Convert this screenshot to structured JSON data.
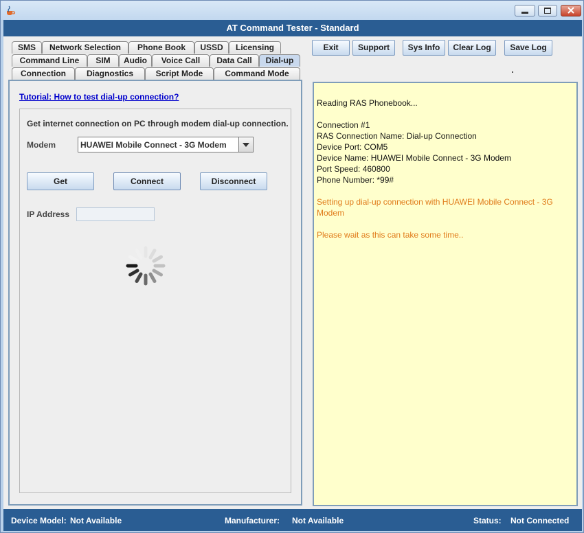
{
  "window": {
    "title": "AT Command Tester - Standard"
  },
  "tabs": {
    "row1": [
      "SMS",
      "Network Selection",
      "Phone Book",
      "USSD",
      "Licensing"
    ],
    "row2": [
      "Command Line",
      "SIM",
      "Audio",
      "Voice Call",
      "Data Call",
      "Dial-up"
    ],
    "row3": [
      "Connection",
      "Diagnostics",
      "Script Mode",
      "Command Mode"
    ],
    "active": "Dial-up"
  },
  "toolbar": {
    "exit": "Exit",
    "support": "Support",
    "sysinfo": "Sys Info",
    "clearlog": "Clear Log",
    "savelog": "Save Log"
  },
  "dialup": {
    "tutorial_link": "Tutorial: How to test dial-up connection?",
    "description": "Get internet connection on PC through modem dial-up connection.",
    "modem_label": "Modem",
    "modem_value": "HUAWEI Mobile Connect - 3G Modem",
    "get_button": "Get",
    "connect_button": "Connect",
    "disconnect_button": "Disconnect",
    "ip_label": "IP Address",
    "ip_value": ""
  },
  "log": {
    "lines": [
      "Reading RAS Phonebook...",
      "Connection #1",
      "RAS Connection Name: Dial-up Connection",
      "Device Port: COM5",
      "Device Name: HUAWEI Mobile Connect - 3G Modem",
      "Port Speed: 460800",
      "Phone Number: *99#",
      "Setting up dial-up connection with HUAWEI Mobile Connect - 3G",
      "Modem",
      "Please wait as this can take some time.."
    ],
    "colors": {
      "normal": "#111111",
      "status": "#e07b1a"
    }
  },
  "statusbar": {
    "device_model_label": "Device Model:",
    "device_model_value": "Not Available",
    "manufacturer_label": "Manufacturer:",
    "manufacturer_value": "Not Available",
    "status_label": "Status:",
    "status_value": "Not Connected"
  },
  "icons": {
    "app": "java-coffee-icon",
    "minimize": "minimize-icon",
    "maximize": "maximize-icon",
    "close": "close-icon",
    "dropdown": "chevron-down-icon",
    "spinner": "loading-spinner-icon"
  },
  "colors": {
    "titlebar": "#2a5d93",
    "log_background": "#ffffcc",
    "link": "#0000cc"
  }
}
